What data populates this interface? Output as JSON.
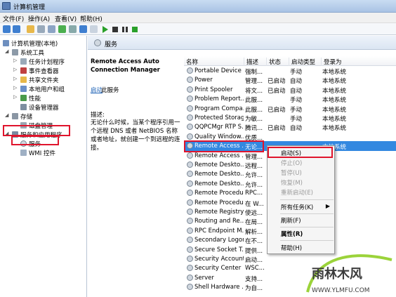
{
  "window": {
    "title": "计算机管理"
  },
  "menu": [
    "文件(F)",
    "操作(A)",
    "查看(V)",
    "帮助(H)"
  ],
  "tree": {
    "root": "计算机管理(本地)",
    "items": [
      {
        "label": "系统工具"
      },
      {
        "label": "任务计划程序"
      },
      {
        "label": "事件查看器"
      },
      {
        "label": "共享文件夹"
      },
      {
        "label": "本地用户和组"
      },
      {
        "label": "性能"
      },
      {
        "label": "设备管理器"
      },
      {
        "label": "存储"
      },
      {
        "label": "磁盘管理"
      },
      {
        "label": "服务和应用程序"
      },
      {
        "label": "服务"
      },
      {
        "label": "WMI 控件"
      }
    ]
  },
  "services_header": {
    "title": "服务"
  },
  "detail": {
    "name": "Remote Access Auto Connection Manager",
    "start_link": "启动",
    "start_rest": "此服务",
    "desc_label": "描述:",
    "desc_text": "无论什么时候，当某个程序引用一个远程 DNS 或者 NetBIOS 名称或者地址，就创建一个到远程的连接。"
  },
  "columns": [
    "名称",
    "描述",
    "状态",
    "启动类型",
    "登录为"
  ],
  "rows": [
    [
      "Portable Device ...",
      "强制...",
      "",
      "手动",
      "本地系统"
    ],
    [
      "Power",
      "管理...",
      "已启动",
      "自动",
      "本地系统"
    ],
    [
      "Print Spooler",
      "将文...",
      "已启动",
      "自动",
      "本地系统"
    ],
    [
      "Problem Report...",
      "此服...",
      "",
      "手动",
      "本地系统"
    ],
    [
      "Program Compa...",
      "此服...",
      "已启动",
      "手动",
      "本地系统"
    ],
    [
      "Protected Storage",
      "为敏...",
      "",
      "手动",
      "本地系统"
    ],
    [
      "QQPCMgr RTP S...",
      "腾讯...",
      "已启动",
      "自动",
      "本地系统"
    ],
    [
      "Quality Window...",
      "优质...",
      "",
      "",
      ""
    ],
    [
      "Remote Access ...",
      "无论...",
      "",
      "",
      "本地系统"
    ],
    [
      "Remote Access ...",
      "管理...",
      "",
      "",
      ""
    ],
    [
      "Remote Deskto...",
      "远程...",
      "",
      "",
      ""
    ],
    [
      "Remote Deskto...",
      "允许...",
      "",
      "",
      ""
    ],
    [
      "Remote Deskto...",
      "允许...",
      "",
      "",
      ""
    ],
    [
      "Remote Procedu...",
      "RPC...",
      "",
      "",
      ""
    ],
    [
      "Remote Procedu...",
      "在 W...",
      "",
      "",
      ""
    ],
    [
      "Remote Registry",
      "使远...",
      "",
      "",
      ""
    ],
    [
      "Routing and Re...",
      "在局...",
      "",
      "",
      ""
    ],
    [
      "RPC Endpoint M...",
      "解析...",
      "",
      "",
      ""
    ],
    [
      "Secondary Logon",
      "在不...",
      "",
      "",
      ""
    ],
    [
      "Secure Socket T...",
      "提供...",
      "",
      "",
      ""
    ],
    [
      "Security Account...",
      "启动...",
      "",
      "",
      ""
    ],
    [
      "Security Center",
      "WSC...",
      "",
      "",
      ""
    ],
    [
      "Server",
      "支持...",
      "",
      "",
      ""
    ],
    [
      "Shell Hardware ...",
      "为自...",
      "",
      "",
      ""
    ]
  ],
  "context_menu": {
    "start": "启动(S)",
    "stop": "停止(O)",
    "pause": "暂停(U)",
    "resume": "恢复(M)",
    "restart": "重新启动(E)",
    "all_tasks": "所有任务(K)",
    "refresh": "刷新(F)",
    "properties": "属性(R)",
    "help": "帮助(H)"
  },
  "watermark": {
    "brand": "雨林木风",
    "url": "WWW.YLMFU.COM"
  },
  "colors": {
    "selection": "#3388e0",
    "highlight_box": "#e0142c",
    "link": "#1a5fb4"
  }
}
